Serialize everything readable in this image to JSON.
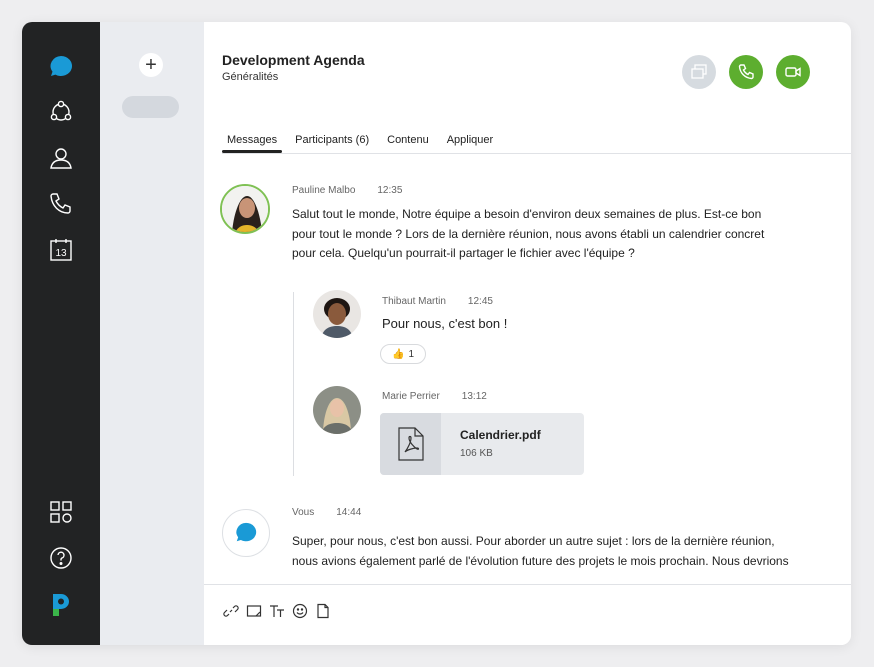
{
  "header": {
    "title": "Development Agenda",
    "subtitle": "Généralités"
  },
  "tabs": [
    {
      "label": "Messages",
      "active": true
    },
    {
      "label": "Participants  (6)"
    },
    {
      "label": "Contenu"
    },
    {
      "label": "Appliquer"
    }
  ],
  "sidebar": {
    "add_label": "+",
    "calendar_day": "13"
  },
  "messages": [
    {
      "author": "Pauline Malbo",
      "time": "12:35",
      "text": "Salut tout le monde, Notre équipe a besoin d'environ deux semaines de plus. Est-ce bon pour tout le monde ? Lors de la dernière réunion, nous avons établi un calendrier concret pour cela. Quelqu'un pourrait-il partager le fichier avec l'équipe ?"
    },
    {
      "author": "Thibaut Martin",
      "time": "12:45",
      "text": "Pour nous, c'est bon !",
      "reaction": {
        "emoji": "👍",
        "count": "1"
      }
    },
    {
      "author": "Marie Perrier",
      "time": "13:12",
      "file": {
        "name": "Calendrier.pdf",
        "size": "106 KB"
      }
    },
    {
      "author": "Vous",
      "time": "14:44",
      "text": "Super, pour nous, c'est bon aussi. Pour aborder un autre sujet : lors de la dernière réunion, nous avions également parlé de l'évolution future des projets le mois prochain. Nous devrions"
    }
  ],
  "colors": {
    "rail": "#222324",
    "accent_blue": "#1a9ad6",
    "call_green": "#5dae2f",
    "logo_green": "#3bb54a"
  }
}
